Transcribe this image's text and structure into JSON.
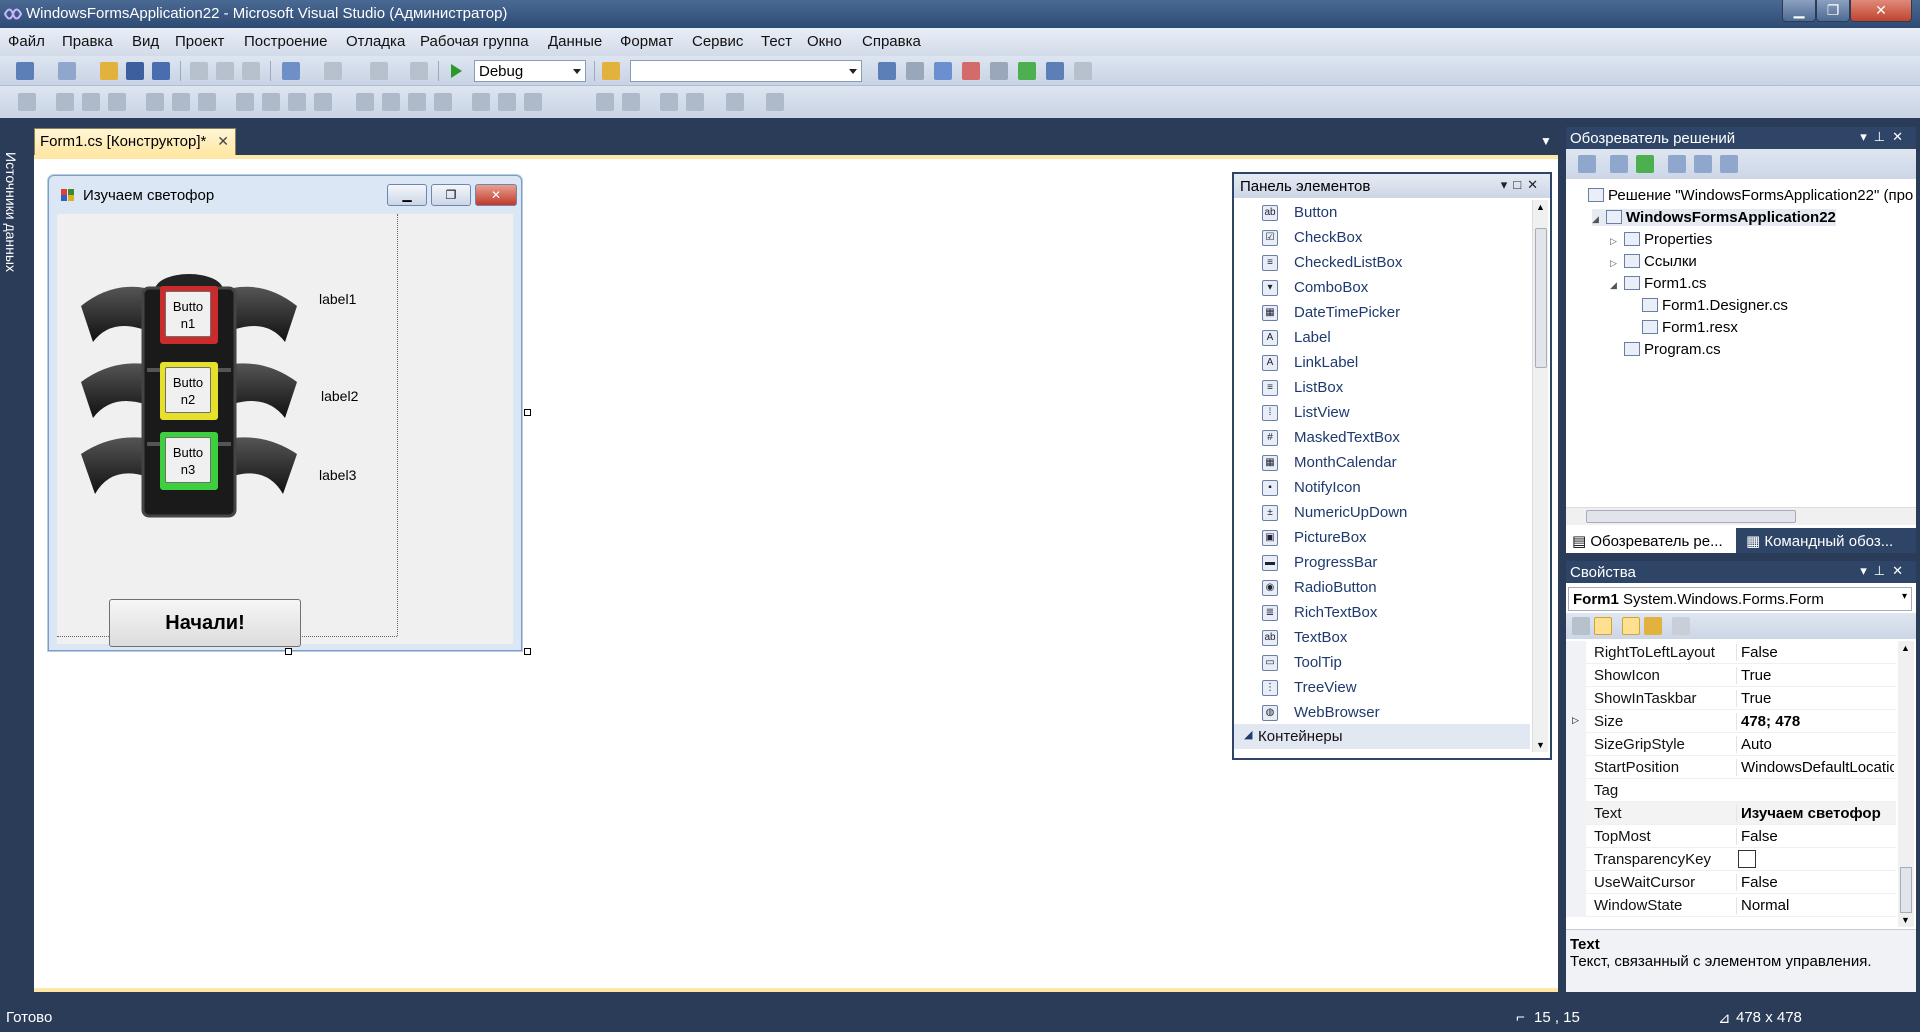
{
  "window": {
    "title": "WindowsFormsApplication22 - Microsoft Visual Studio (Администратор)",
    "minimize": "▁",
    "maximize": "❐",
    "close": "✕"
  },
  "menu": [
    "Файл",
    "Правка",
    "Вид",
    "Проект",
    "Построение",
    "Отладка",
    "Рабочая группа",
    "Данные",
    "Формат",
    "Сервис",
    "Тест",
    "Окно",
    "Справка"
  ],
  "toolbar": {
    "config": "Debug",
    "platform": ""
  },
  "left_strip": {
    "label": "Источники данных"
  },
  "doc_tab": {
    "label": "Form1.cs [Конструктор]*",
    "close": "✕"
  },
  "form": {
    "title": "Изучаем светофор",
    "buttons": [
      "Butto n1",
      "Butto n2",
      "Butto n3"
    ],
    "labels": [
      "label1",
      "label2",
      "label3"
    ],
    "start_button": "Начали!",
    "lamp_colors": [
      "#cc2b2b",
      "#e5e12a",
      "#3dcf3d"
    ]
  },
  "toolbox": {
    "title": "Панель элементов",
    "items": [
      {
        "label": "Button",
        "icon": "ab"
      },
      {
        "label": "CheckBox",
        "icon": "☑"
      },
      {
        "label": "CheckedListBox",
        "icon": "≡"
      },
      {
        "label": "ComboBox",
        "icon": "▾"
      },
      {
        "label": "DateTimePicker",
        "icon": "▦"
      },
      {
        "label": "Label",
        "icon": "A"
      },
      {
        "label": "LinkLabel",
        "icon": "A"
      },
      {
        "label": "ListBox",
        "icon": "≡"
      },
      {
        "label": "ListView",
        "icon": "⁞"
      },
      {
        "label": "MaskedTextBox",
        "icon": "#"
      },
      {
        "label": "MonthCalendar",
        "icon": "▦"
      },
      {
        "label": "NotifyIcon",
        "icon": "▪"
      },
      {
        "label": "NumericUpDown",
        "icon": "±"
      },
      {
        "label": "PictureBox",
        "icon": "▣"
      },
      {
        "label": "ProgressBar",
        "icon": "▬"
      },
      {
        "label": "RadioButton",
        "icon": "◉"
      },
      {
        "label": "RichTextBox",
        "icon": "≣"
      },
      {
        "label": "TextBox",
        "icon": "ab"
      },
      {
        "label": "ToolTip",
        "icon": "▭"
      },
      {
        "label": "TreeView",
        "icon": "⋮"
      },
      {
        "label": "WebBrowser",
        "icon": "◍"
      }
    ],
    "group": "Контейнеры"
  },
  "solution": {
    "title": "Обозреватель решений",
    "nodes": [
      {
        "label": "Решение \"WindowsFormsApplication22\" (про",
        "level": 0,
        "bold": false
      },
      {
        "label": "WindowsFormsApplication22",
        "level": 1,
        "bold": true
      },
      {
        "label": "Properties",
        "level": 2,
        "bold": false
      },
      {
        "label": "Ссылки",
        "level": 2,
        "bold": false
      },
      {
        "label": "Form1.cs",
        "level": 2,
        "bold": false
      },
      {
        "label": "Form1.Designer.cs",
        "level": 3,
        "bold": false
      },
      {
        "label": "Form1.resx",
        "level": 3,
        "bold": false
      },
      {
        "label": "Program.cs",
        "level": 2,
        "bold": false
      }
    ],
    "tabs": [
      "Обозреватель ре...",
      "Командный обоз..."
    ]
  },
  "properties": {
    "title": "Свойства",
    "object_name": "Form1",
    "object_type": "System.Windows.Forms.Form",
    "rows": [
      {
        "name": "RightToLeftLayout",
        "value": "False",
        "bold": false
      },
      {
        "name": "ShowIcon",
        "value": "True",
        "bold": false
      },
      {
        "name": "ShowInTaskbar",
        "value": "True",
        "bold": false
      },
      {
        "name": "Size",
        "value": "478; 478",
        "bold": true
      },
      {
        "name": "SizeGripStyle",
        "value": "Auto",
        "bold": false
      },
      {
        "name": "StartPosition",
        "value": "WindowsDefaultLocatic",
        "bold": false
      },
      {
        "name": "Tag",
        "value": "",
        "bold": false
      },
      {
        "name": "Text",
        "value": "Изучаем светофор",
        "bold": true
      },
      {
        "name": "TopMost",
        "value": "False",
        "bold": false
      },
      {
        "name": "TransparencyKey",
        "value": "",
        "bold": false
      },
      {
        "name": "UseWaitCursor",
        "value": "False",
        "bold": false
      },
      {
        "name": "WindowState",
        "value": "Normal",
        "bold": false
      }
    ],
    "desc_title": "Text",
    "desc_text": "Текст, связанный с элементом управления."
  },
  "status": {
    "text": "Готово",
    "position": "15 , 15",
    "size": "478 x 478"
  }
}
